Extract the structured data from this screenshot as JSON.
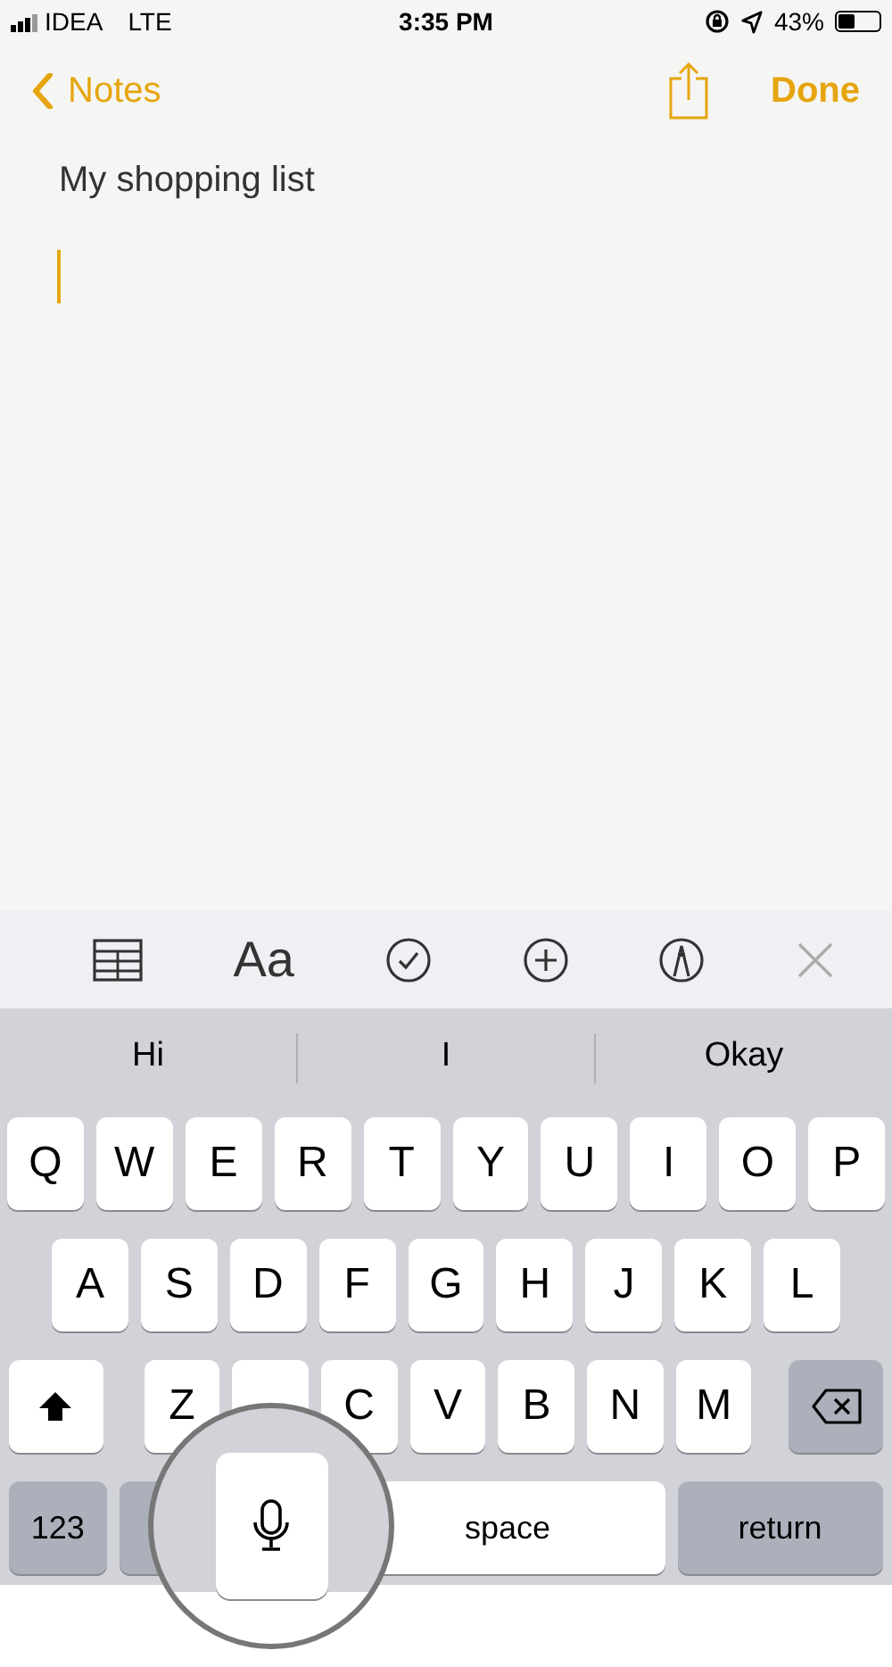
{
  "status_bar": {
    "carrier": "IDEA",
    "network": "LTE",
    "time": "3:35 PM",
    "battery": "43%"
  },
  "nav": {
    "back": "Notes",
    "done": "Done"
  },
  "note": {
    "title": "My shopping list"
  },
  "toolbar": {
    "format_label": "Aa"
  },
  "suggestions": [
    "Hi",
    "I",
    "Okay"
  ],
  "keyboard": {
    "rows": [
      {
        "keys": [
          {
            "kind": "letter",
            "label": "Q"
          },
          {
            "kind": "letter",
            "label": "W"
          },
          {
            "kind": "letter",
            "label": "E"
          },
          {
            "kind": "letter",
            "label": "R"
          },
          {
            "kind": "letter",
            "label": "T"
          },
          {
            "kind": "letter",
            "label": "Y"
          },
          {
            "kind": "letter",
            "label": "U"
          },
          {
            "kind": "letter",
            "label": "I"
          },
          {
            "kind": "letter",
            "label": "O"
          },
          {
            "kind": "letter",
            "label": "P"
          }
        ]
      },
      {
        "keys": [
          {
            "kind": "letter",
            "label": "A"
          },
          {
            "kind": "letter",
            "label": "S"
          },
          {
            "kind": "letter",
            "label": "D"
          },
          {
            "kind": "letter",
            "label": "F"
          },
          {
            "kind": "letter",
            "label": "G"
          },
          {
            "kind": "letter",
            "label": "H"
          },
          {
            "kind": "letter",
            "label": "J"
          },
          {
            "kind": "letter",
            "label": "K"
          },
          {
            "kind": "letter",
            "label": "L"
          }
        ]
      },
      {
        "keys": [
          {
            "kind": "shift"
          },
          {
            "kind": "letter",
            "label": "Z"
          },
          {
            "kind": "letter"
          },
          {
            "kind": "letter",
            "label": "C"
          },
          {
            "kind": "letter",
            "label": "V"
          },
          {
            "kind": "letter",
            "label": "B"
          },
          {
            "kind": "letter",
            "label": "N"
          },
          {
            "kind": "letter",
            "label": "M"
          },
          {
            "kind": "delete"
          }
        ]
      },
      {
        "keys": [
          {
            "kind": "numbers",
            "label": "123"
          },
          {
            "kind": "emoji"
          },
          {
            "kind": "mic"
          },
          {
            "kind": "space",
            "label": "space"
          },
          {
            "kind": "return",
            "label": "return"
          }
        ]
      }
    ]
  }
}
